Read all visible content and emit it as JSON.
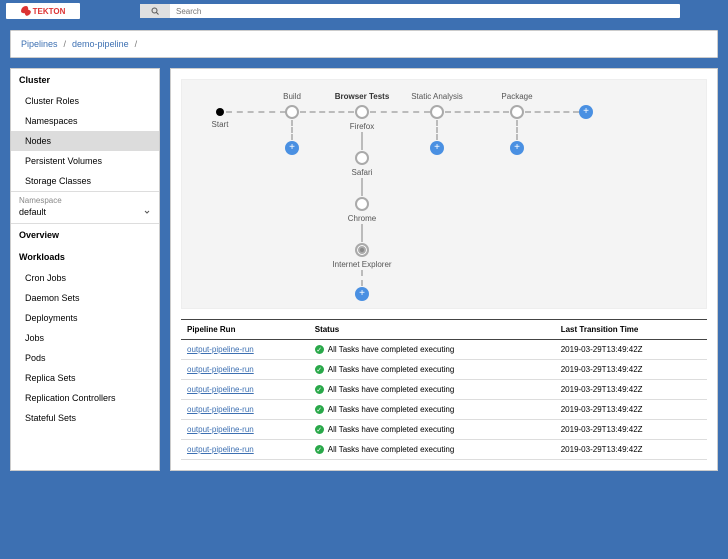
{
  "brand": "TEKTON",
  "search": {
    "placeholder": "Search"
  },
  "breadcrumbs": [
    "Pipelines",
    "demo-pipeline"
  ],
  "sidebar": {
    "clusterHead": "Cluster",
    "clusterItems": [
      "Cluster Roles",
      "Namespaces",
      "Nodes",
      "Persistent Volumes",
      "Storage Classes"
    ],
    "clusterActive": 2,
    "nsLabel": "Namespace",
    "nsValue": "default",
    "overview": "Overview",
    "workloadsHead": "Workloads",
    "workloadsItems": [
      "Cron Jobs",
      "Daemon Sets",
      "Deployments",
      "Jobs",
      "Pods",
      "Replica Sets",
      "Replication Controllers",
      "Stateful Sets"
    ]
  },
  "diagram": {
    "startLabel": "Start",
    "cols": [
      {
        "label": "Build",
        "bold": false
      },
      {
        "label": "Browser Tests",
        "bold": true
      },
      {
        "label": "Static Analysis",
        "bold": false
      },
      {
        "label": "Package",
        "bold": false
      }
    ],
    "browsers": [
      "Firefox",
      "Safari",
      "Chrome",
      "Internet Explorer"
    ]
  },
  "tableHeaders": [
    "Pipeline Run",
    "Status",
    "Last Transition Time"
  ],
  "statusText": "All Tasks have completed executing",
  "rows": [
    {
      "name": "output-pipeline-run",
      "time": "2019-03-29T13:49:42Z"
    },
    {
      "name": "output-pipeline-run",
      "time": "2019-03-29T13:49:42Z"
    },
    {
      "name": "output-pipeline-run",
      "time": "2019-03-29T13:49:42Z"
    },
    {
      "name": "output-pipeline-run",
      "time": "2019-03-29T13:49:42Z"
    },
    {
      "name": "output-pipeline-run",
      "time": "2019-03-29T13:49:42Z"
    },
    {
      "name": "output-pipeline-run",
      "time": "2019-03-29T13:49:42Z"
    }
  ]
}
